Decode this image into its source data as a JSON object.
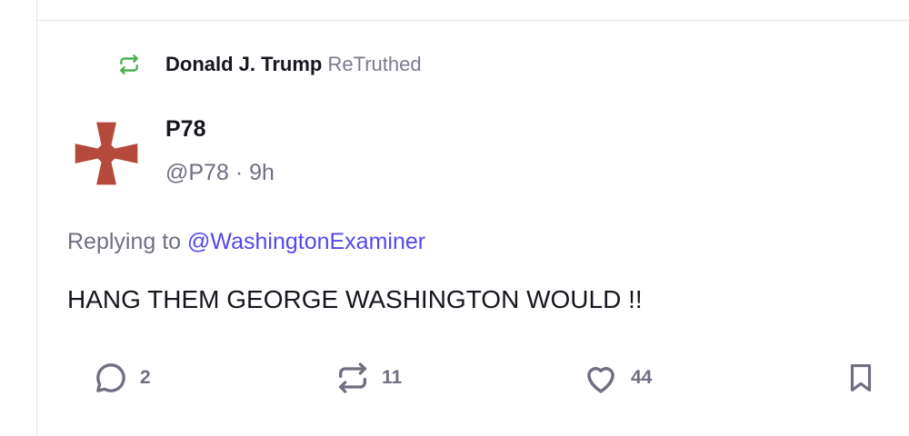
{
  "retruth": {
    "user": "Donald J. Trump",
    "action": "ReTruthed",
    "icon": "retruth-icon",
    "icon_color": "#4caf50"
  },
  "post": {
    "display_name": "P78",
    "handle": "@P78",
    "separator": "·",
    "time": "9h",
    "replying_prefix": "Replying to",
    "replying_handle": "@WashingtonExaminer",
    "text": "HANG THEM GEORGE WASHINGTON WOULD !!",
    "avatar_icon": "cross-pattee-icon",
    "avatar_color": "#b5493b"
  },
  "actions": {
    "reply": {
      "icon": "reply-icon",
      "count": "2"
    },
    "retruth": {
      "icon": "retruth-icon",
      "count": "11"
    },
    "like": {
      "icon": "heart-icon",
      "count": "44"
    },
    "bookmark": {
      "icon": "bookmark-icon"
    }
  },
  "colors": {
    "text_primary": "#16161f",
    "text_secondary": "#6f6f82",
    "link": "#5448ee",
    "action_icon": "#6f6f82"
  }
}
